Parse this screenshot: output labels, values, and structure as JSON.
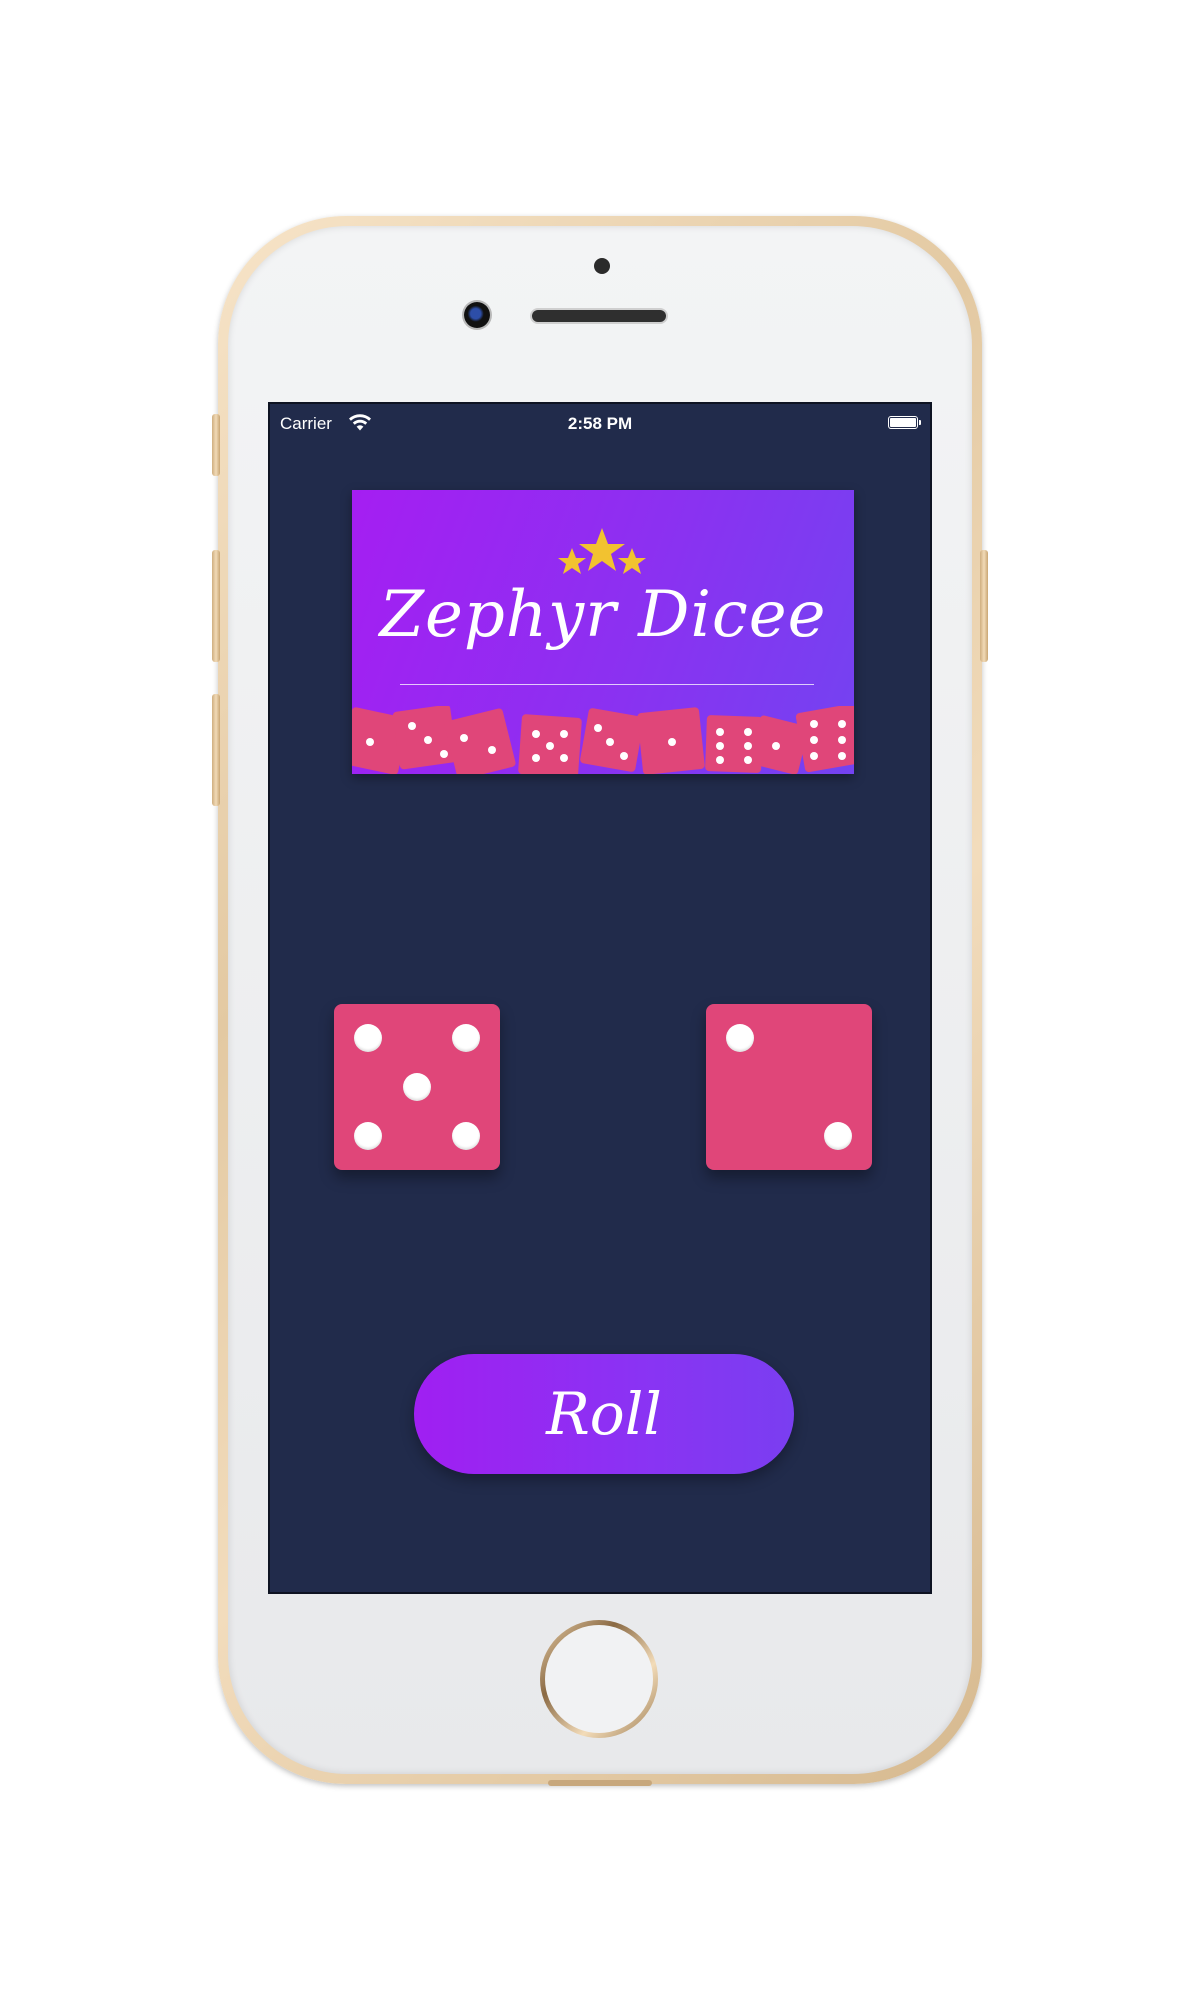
{
  "status_bar": {
    "carrier": "Carrier",
    "time": "2:58 PM"
  },
  "logo": {
    "title": "Zephyr Dicee",
    "star_color": "#f2c230"
  },
  "dice": {
    "left_value": 5,
    "right_value": 2,
    "color": "#e04679",
    "pip_color": "#ffffff"
  },
  "roll_button": {
    "label": "Roll"
  },
  "colors": {
    "screen_background": "#212b4b",
    "accent_purple": "#9b27f2"
  }
}
